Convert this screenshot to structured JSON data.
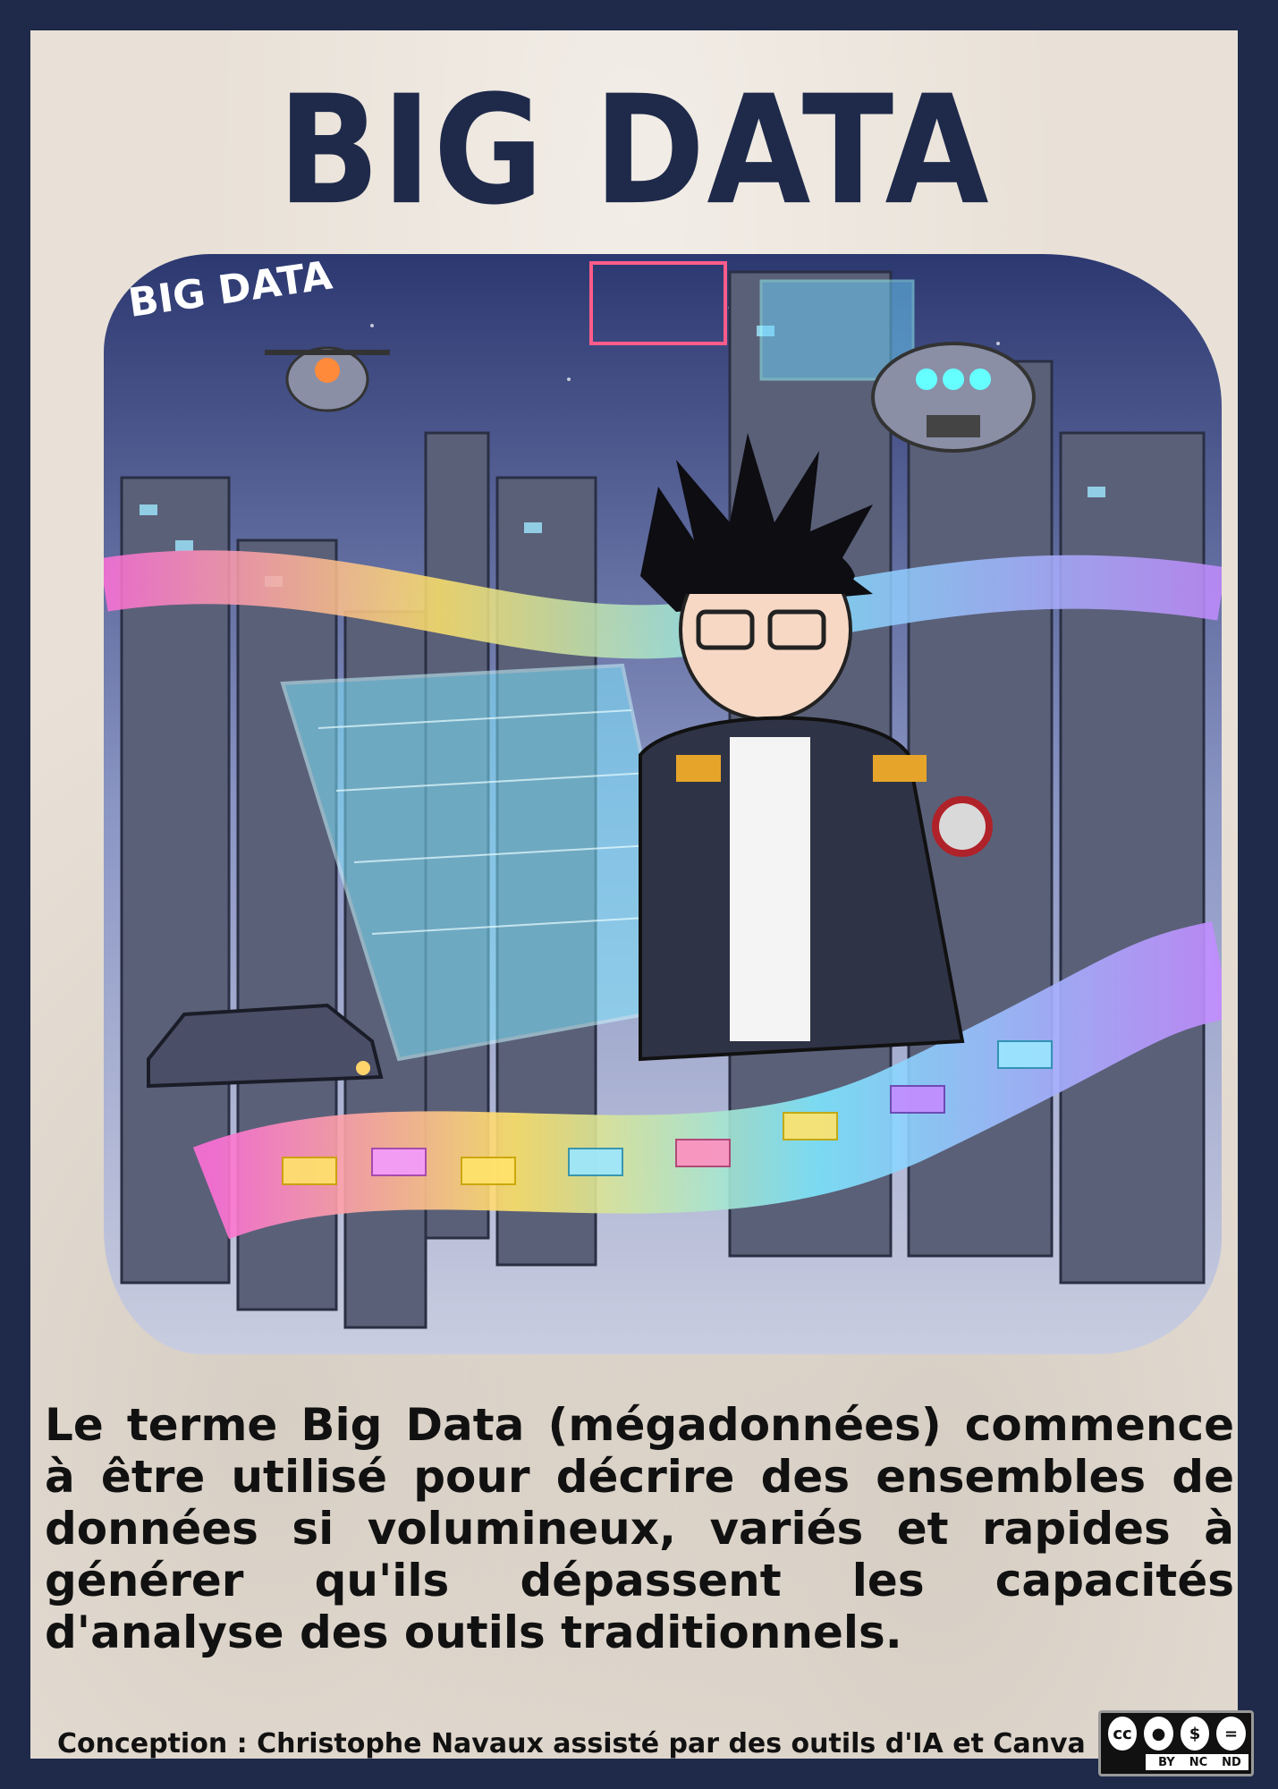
{
  "poster": {
    "title": "BIG DATA",
    "illustration_text": "BIG DATA",
    "body": "Le terme Big Data (mégadonnées) commence à être utilisé pour décrire des ensembles de données si volumineux, variés et rapides à générer qu'ils dépassent les capacités d'analyse des outils traditionnels.",
    "credit": "Conception : Christophe Navaux  assisté par des outils d'IA et Canva",
    "license": {
      "cc": "cc",
      "by": "BY",
      "nc": "NC",
      "nd": "ND"
    }
  },
  "colors": {
    "frame": "#1f2a4a",
    "paper": "#e9e1d7",
    "title": "#1f2a4a",
    "text": "#111111"
  }
}
